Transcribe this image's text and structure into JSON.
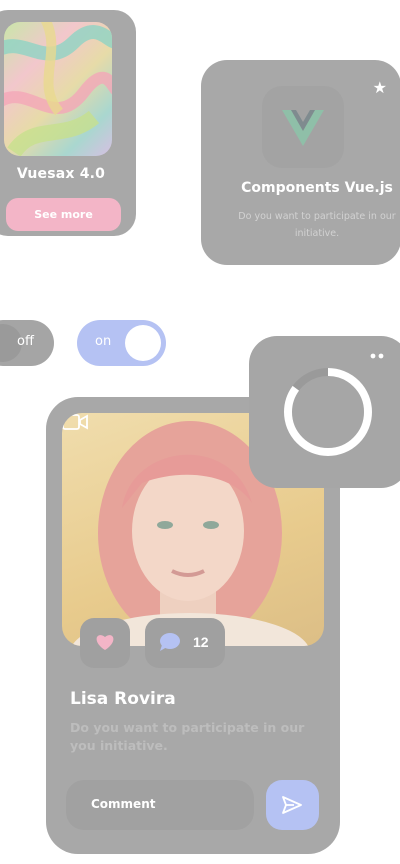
{
  "vuesax_card": {
    "title": "Vuesax 4.0",
    "button_label": "See more"
  },
  "vue_card": {
    "title": "Components Vue.js",
    "description": "Do you want to participate in our initiative."
  },
  "toggles": {
    "off_label": "off",
    "on_label": "on"
  },
  "profile_card": {
    "name": "Lisa Rovira",
    "description": "Do you want to participate in our you initiative.",
    "comment_count": "12",
    "comment_placeholder": "Comment"
  },
  "loader": {
    "progress": 0.85
  },
  "icons": [
    "star-icon",
    "vue-logo-icon",
    "video-camera-icon",
    "heart-icon",
    "chat-bubble-icon",
    "send-icon",
    "more-dots-icon"
  ],
  "colors": {
    "accent_pink": "#f3b5c7",
    "accent_blue": "#b5c2f3",
    "card_gray": "#a8a8a8"
  }
}
